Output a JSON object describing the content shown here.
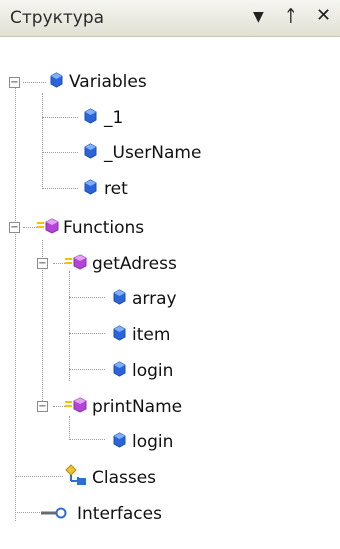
{
  "panel": {
    "title": "Структура",
    "buttons": {
      "dropdown": "▼",
      "pin": "ᛏ",
      "close": "✕"
    }
  },
  "tree": {
    "variables": {
      "label": "Variables",
      "expanded": true,
      "items": [
        {
          "label": "_1"
        },
        {
          "label": "_UserName"
        },
        {
          "label": "ret"
        }
      ]
    },
    "functions": {
      "label": "Functions",
      "expanded": true,
      "items": [
        {
          "label": "getAdress",
          "expanded": true,
          "items": [
            {
              "label": "array"
            },
            {
              "label": "item"
            },
            {
              "label": "login"
            }
          ]
        },
        {
          "label": "printName",
          "expanded": true,
          "items": [
            {
              "label": "login"
            }
          ]
        }
      ]
    },
    "classes": {
      "label": "Classes"
    },
    "interfaces": {
      "label": "Interfaces"
    }
  },
  "icons": {
    "toggle": "minus-box-icon",
    "variable": "blue-cube-icon",
    "function": "purple-cube-icon",
    "classes": "class-tree-icon",
    "interfaces": "lollipop-interface-icon"
  },
  "colors": {
    "header_bg": "#e9e8dd",
    "variable_icon": "#2a64d8",
    "function_icon": "#b245d6",
    "class_icon": "#f0c22f",
    "interface_icon": "#2d6fd7"
  }
}
